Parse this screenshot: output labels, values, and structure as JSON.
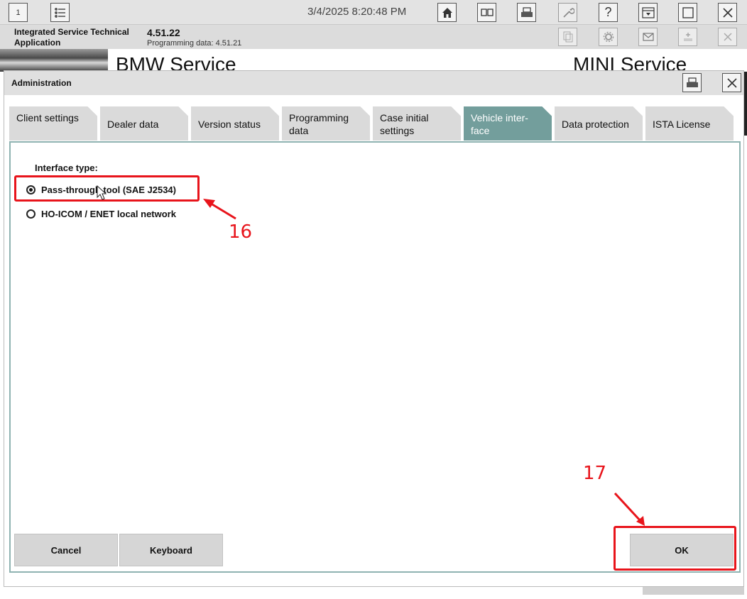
{
  "toolbar": {
    "page_number": "1",
    "datetime": "3/4/2025 8:20:48 PM",
    "icons": [
      "list-icon",
      "home-icon",
      "split-view-icon",
      "print-icon",
      "wrench-icon",
      "help-icon",
      "dropdown-window-icon",
      "maximize-icon",
      "close-icon"
    ]
  },
  "app": {
    "name": "Integrated Service Technical Application",
    "version": "4.51.22",
    "programming_data": "Programming data:  4.51.21"
  },
  "brand": {
    "left": "BMW Service",
    "right": "MINI Service"
  },
  "dialog": {
    "title": "Administration",
    "tabs": [
      {
        "label": "Client settings",
        "active": false
      },
      {
        "label": "Dealer data",
        "active": false
      },
      {
        "label": "Version status",
        "active": false
      },
      {
        "label": "Programming data",
        "active": false
      },
      {
        "label": "Case initial settings",
        "active": false
      },
      {
        "label": "Vehicle inter-face",
        "active": true
      },
      {
        "label": "Data protection",
        "active": false
      },
      {
        "label": "ISTA License",
        "active": false
      }
    ],
    "interface_label": "Interface type:",
    "options": [
      {
        "label": "Pass-through tool (SAE J2534)",
        "selected": true
      },
      {
        "label": "HO-ICOM / ENET local network",
        "selected": false
      }
    ],
    "buttons": {
      "cancel": "Cancel",
      "keyboard": "Keyboard",
      "ok": "OK"
    }
  },
  "annotations": {
    "step_16": "16",
    "step_17": "17",
    "color": "#e8141b"
  },
  "colors": {
    "active_tab": "#739e9c",
    "content_border": "#8fb3b1"
  }
}
